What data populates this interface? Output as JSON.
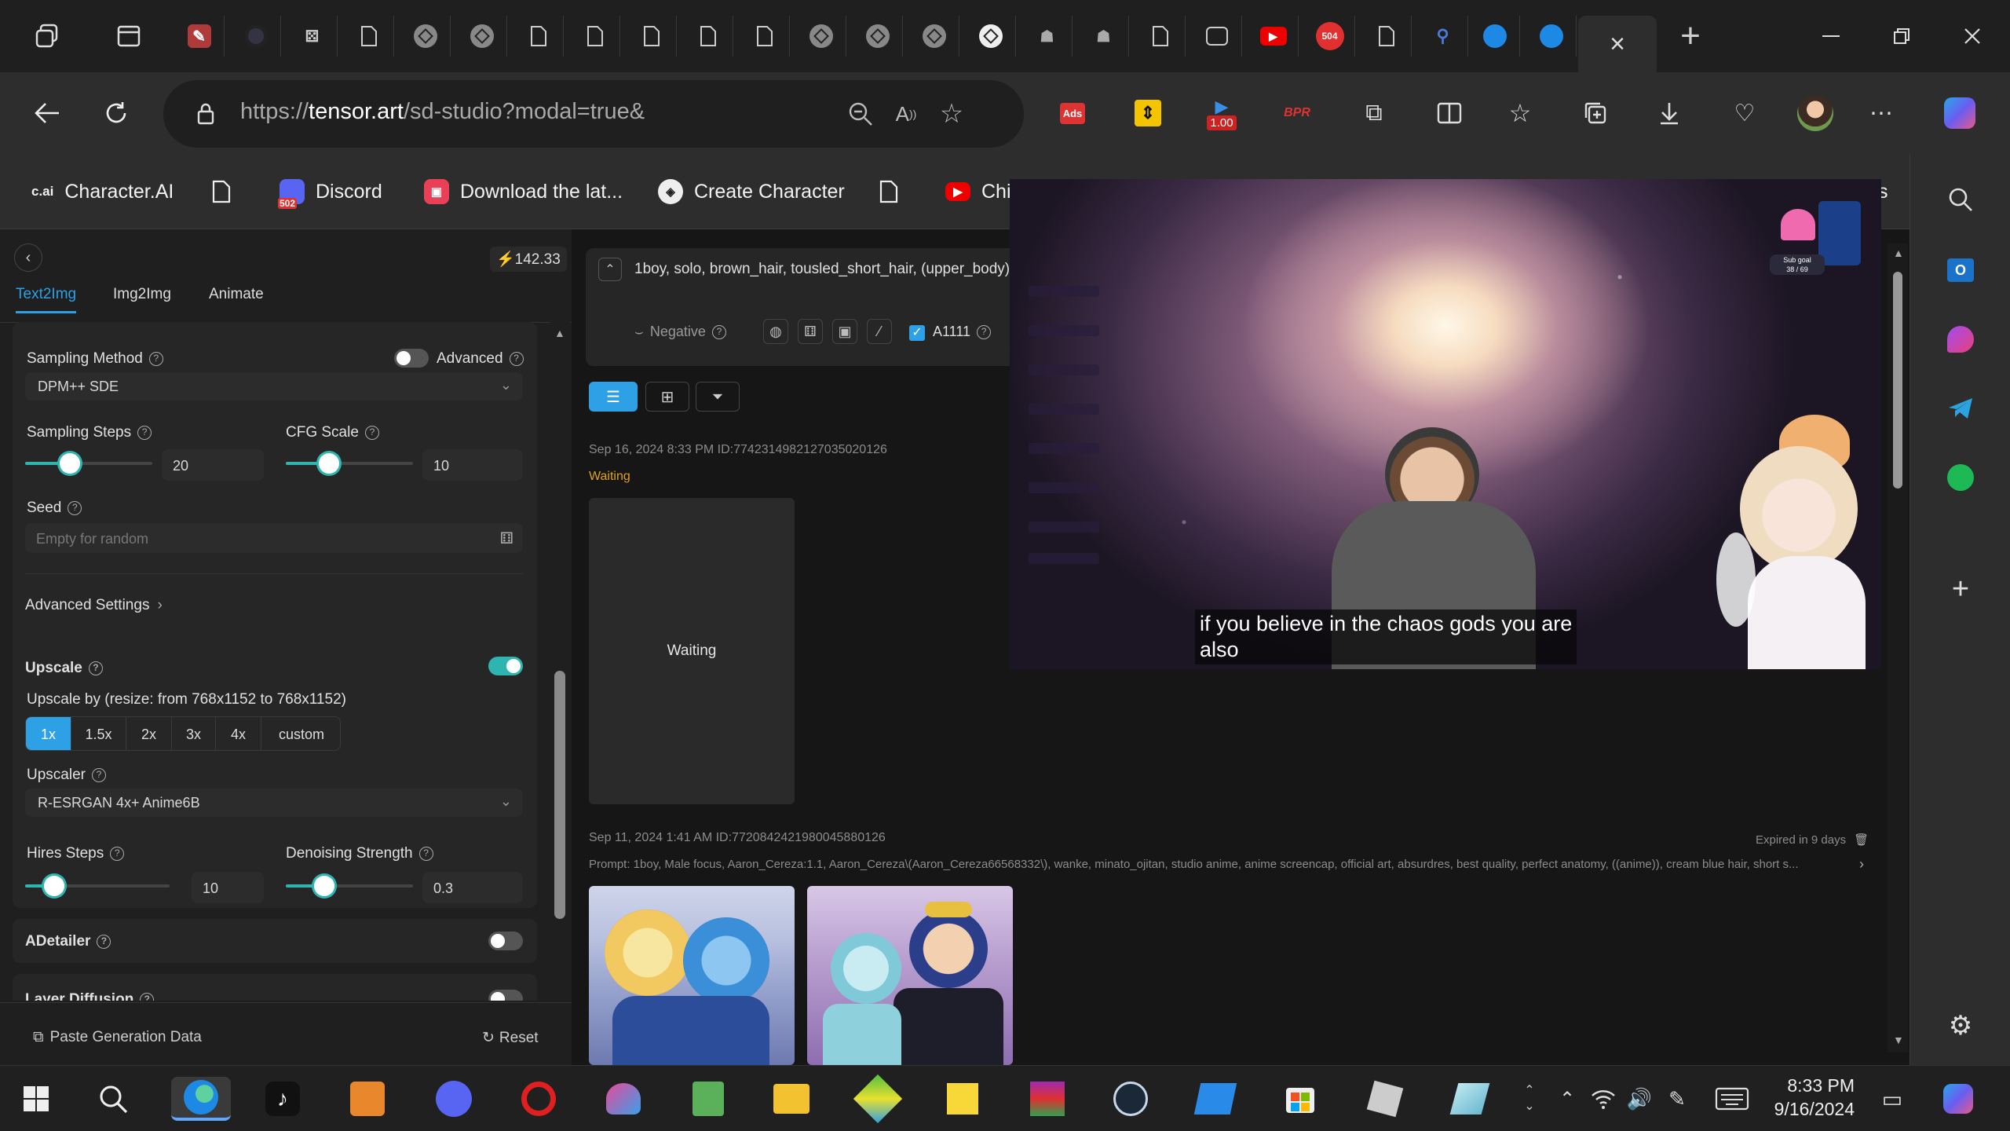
{
  "browser": {
    "url_prefix": "https://",
    "url_domain": "tensor.art",
    "url_path": "/sd-studio?modal=true&",
    "tab_badge_504": "504",
    "ext_badge_100": "1.00",
    "ext_ads": "Ads",
    "ext_bpr": "BPR",
    "new_tab": "+",
    "close_tab": "×"
  },
  "bookmarks": [
    {
      "icon_text": "c.ai",
      "label": "Character.AI"
    },
    {
      "icon_text": "",
      "label": ""
    },
    {
      "icon_text": "502",
      "label": "Discord"
    },
    {
      "icon_text": "",
      "label": "Download the lat..."
    },
    {
      "icon_text": "",
      "label": "Create Character"
    },
    {
      "icon_text": "",
      "label": ""
    },
    {
      "icon_text": "",
      "label": "Chi"
    }
  ],
  "bookmarks_overflow": "s",
  "panel": {
    "credits": "142.33",
    "tabs": [
      "Text2Img",
      "Img2Img",
      "Animate"
    ],
    "sampling_method_label": "Sampling Method",
    "advanced_label": "Advanced",
    "sampling_method_value": "DPM++ SDE",
    "sampling_steps_label": "Sampling Steps",
    "sampling_steps_value": "20",
    "cfg_label": "CFG Scale",
    "cfg_value": "10",
    "seed_label": "Seed",
    "seed_placeholder": "Empty for random",
    "advanced_settings": "Advanced Settings",
    "upscale_label": "Upscale",
    "upscale_by": "Upscale by (resize: from 768x1152 to 768x1152)",
    "upscale_options": [
      "1x",
      "1.5x",
      "2x",
      "3x",
      "4x",
      "custom"
    ],
    "upscaler_label": "Upscaler",
    "upscaler_value": "R-ESRGAN 4x+ Anime6B",
    "hires_label": "Hires Steps",
    "hires_value": "10",
    "denoise_label": "Denoising Strength",
    "denoise_value": "0.3",
    "adetailer_label": "ADetailer",
    "layer_diffusion_label": "Layer Diffusion",
    "paste_label": "Paste Generation Data",
    "reset_label": "Reset"
  },
  "sliders": {
    "sampling_steps_fraction": 0.35,
    "cfg_fraction": 0.34,
    "hires_fraction": 0.2,
    "denoise_fraction": 0.3
  },
  "results": {
    "prompt": "1boy, solo, brown_hair, tousled_short_hair, (upper_body), u",
    "negative_label": "Negative",
    "a1111_label": "A1111",
    "job1_meta": "Sep 16, 2024 8:33 PM ID:774231498212703502012​6",
    "job1_status": "Waiting",
    "job1_card": "Waiting",
    "job2_meta": "Sep 11, 2024 1:41 AM ID:772084242198004588012​6",
    "job2_expiry": "Expired in 9 days",
    "job2_prompt": "Prompt: 1boy, Male focus, Aaron_Cereza:1.1, Aaron_Cereza\\(Aaron_Cereza66568332\\), wanke, minato_ojitan, studio anime, anime screencap, official art, absurdres, best quality, perfect anatomy, ((anime)), cream blue hair, short s..."
  },
  "video": {
    "caption_line1": "if you believe in the chaos gods you are",
    "caption_line2": "also",
    "sub_goal": "Sub goal",
    "sub_count": "38 / 69"
  },
  "taskbar": {
    "time": "8:33 PM",
    "date": "9/16/2024"
  },
  "colors": {
    "accent_teal": "#2fb5b0",
    "accent_blue": "#2ea0e6",
    "waiting_orange": "#e0a020"
  }
}
